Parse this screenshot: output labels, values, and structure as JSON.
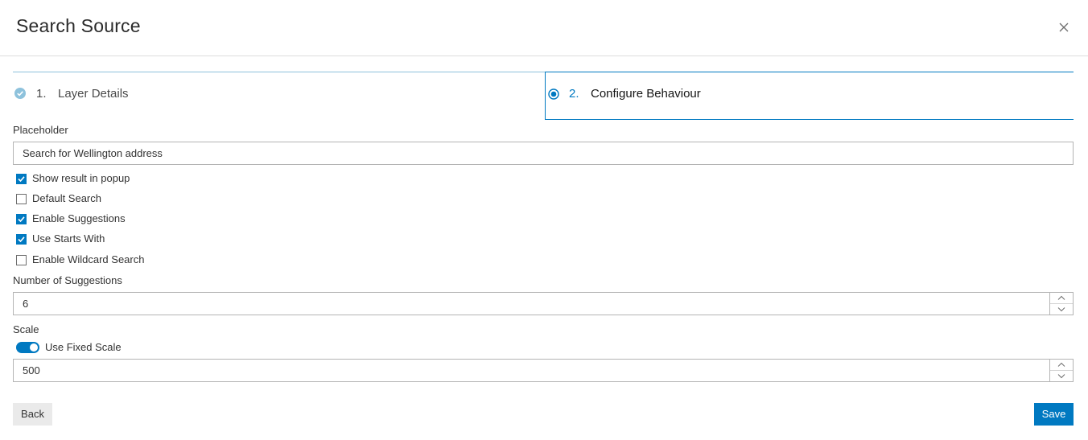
{
  "dialog": {
    "title": "Search Source",
    "close_icon": "close-icon"
  },
  "steps": [
    {
      "number": "1.",
      "label": "Layer Details",
      "state": "completed",
      "icon": "check-circle-icon"
    },
    {
      "number": "2.",
      "label": "Configure Behaviour",
      "state": "active",
      "icon": "radio-active-icon"
    }
  ],
  "form": {
    "placeholder_label": "Placeholder",
    "placeholder_value": "Search for Wellington address",
    "checkboxes": [
      {
        "label": "Show result in popup",
        "checked": true
      },
      {
        "label": "Default Search",
        "checked": false
      },
      {
        "label": "Enable Suggestions",
        "checked": true
      },
      {
        "label": "Use Starts With",
        "checked": true
      },
      {
        "label": "Enable Wildcard Search",
        "checked": false
      }
    ],
    "suggestions_label": "Number of Suggestions",
    "suggestions_value": "6",
    "scale_label": "Scale",
    "fixed_scale_toggle_label": "Use Fixed Scale",
    "fixed_scale_enabled": true,
    "scale_value": "500"
  },
  "footer": {
    "back_label": "Back",
    "save_label": "Save"
  },
  "colors": {
    "accent": "#0079c1",
    "completed_step": "#8ec2dc",
    "neutral_button": "#eaeaea"
  }
}
